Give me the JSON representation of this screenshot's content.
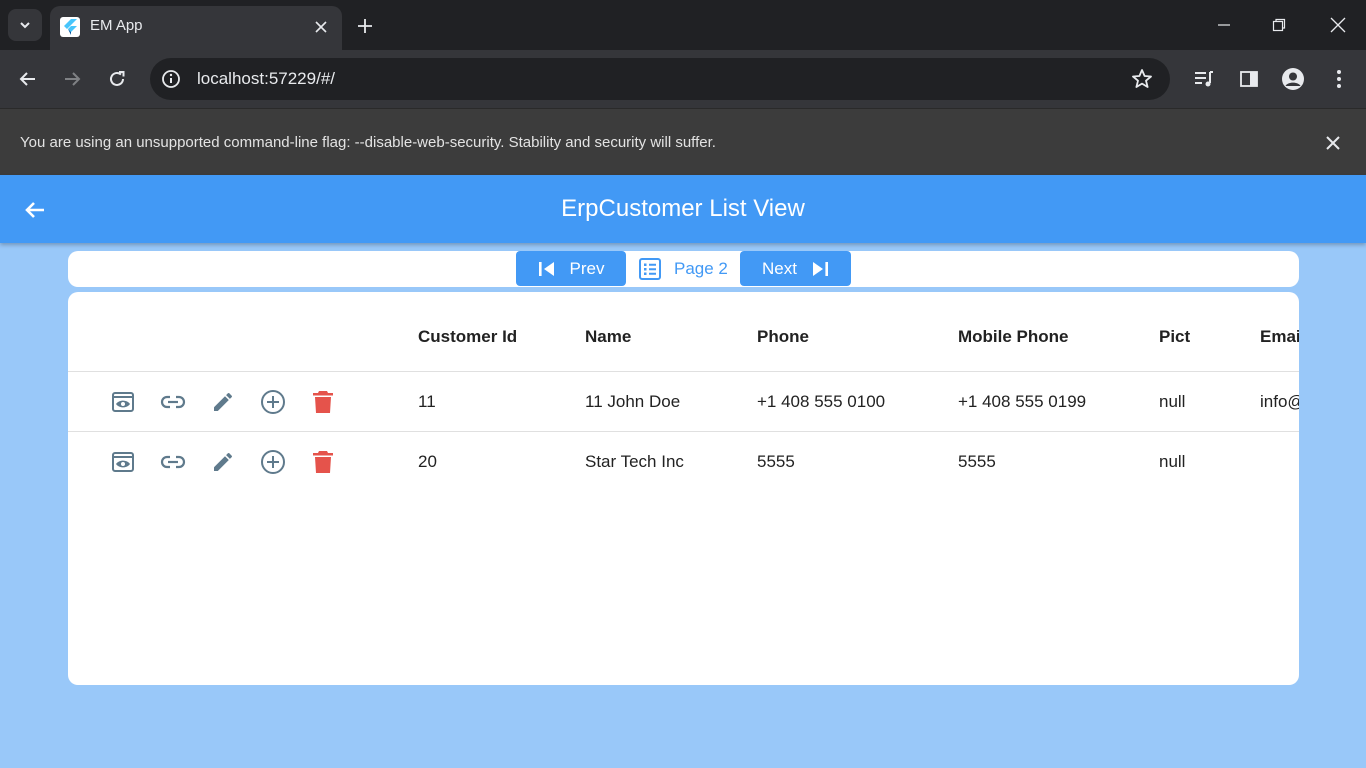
{
  "browser": {
    "tab_title": "EM App",
    "url": "localhost:57229/#/",
    "infobar_message": "You are using an unsupported command-line flag: --disable-web-security. Stability and security will suffer."
  },
  "app": {
    "title": "ErpCustomer List View",
    "pager": {
      "prev_label": "Prev",
      "page_label": "Page 2",
      "next_label": "Next"
    },
    "table": {
      "columns": [
        "Customer Id",
        "Name",
        "Phone",
        "Mobile Phone",
        "Pict",
        "Emai"
      ],
      "rows": [
        {
          "customer_id": "11",
          "name": "11 John Doe",
          "phone": "+1 408 555 0100",
          "mobile_phone": "+1 408 555 0199",
          "pict": "null",
          "email": "info@"
        },
        {
          "customer_id": "20",
          "name": "Star Tech Inc",
          "phone": "5555",
          "mobile_phone": "5555",
          "pict": "null",
          "email": ""
        }
      ],
      "row_actions": [
        "preview-icon",
        "link-icon",
        "edit-icon",
        "add-circle-icon",
        "delete-icon"
      ]
    }
  },
  "colors": {
    "accent": "#4299f5",
    "background": "#99c8f9",
    "action_icon": "#5f7a8c",
    "delete": "#e5534b"
  }
}
